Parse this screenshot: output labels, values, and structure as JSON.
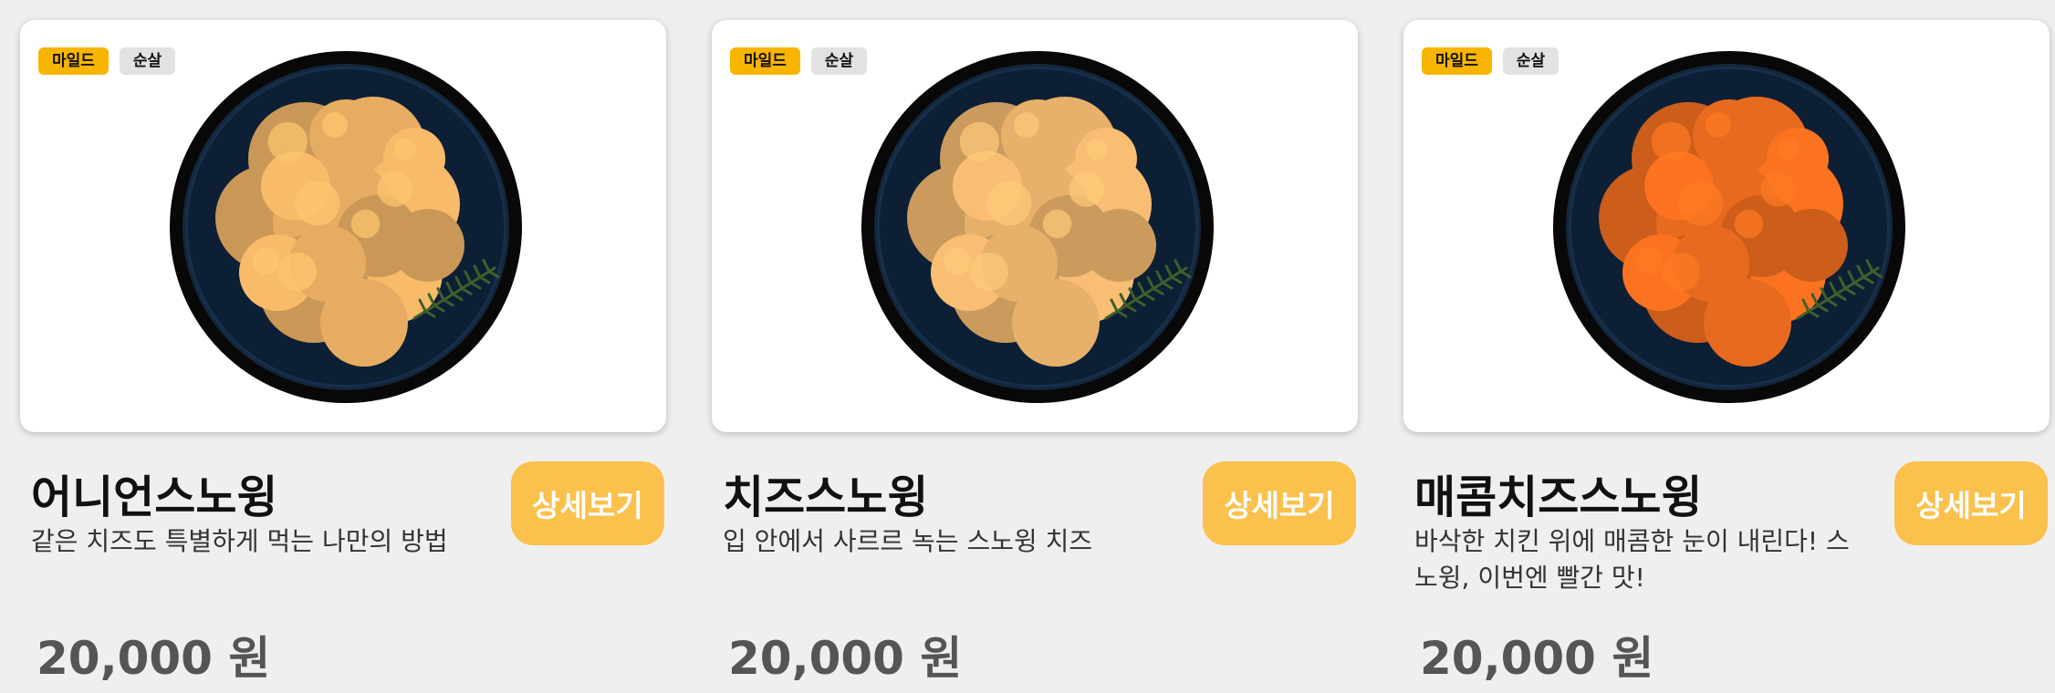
{
  "menu": {
    "items": [
      {
        "tags": [
          "마일드",
          "순살"
        ],
        "name": "어니언스노윙",
        "description": "같은 치즈도 특별하게 먹는 나만의 방법",
        "price": "20,000 원",
        "button": "상세보기",
        "chicken_color": "#e6ad62"
      },
      {
        "tags": [
          "마일드",
          "순살"
        ],
        "name": "치즈스노윙",
        "description": "입 안에서 사르르 녹는 스노윙 치즈",
        "price": "20,000 원",
        "button": "상세보기",
        "chicken_color": "#e7b06b"
      },
      {
        "tags": [
          "마일드",
          "순살"
        ],
        "name": "매콤치즈스노윙",
        "description": "바삭한 치킨 위에 매콤한 눈이 내린다! 스노윙, 이번엔 빨간 맛!",
        "price": "20,000 원",
        "button": "상세보기",
        "chicken_color": "#e86a1e"
      }
    ]
  },
  "colors": {
    "tag_mild": "#f7b500",
    "tag_boneless": "#e2e2e2",
    "button": "#fac14c",
    "plate": "#0d1f35"
  }
}
